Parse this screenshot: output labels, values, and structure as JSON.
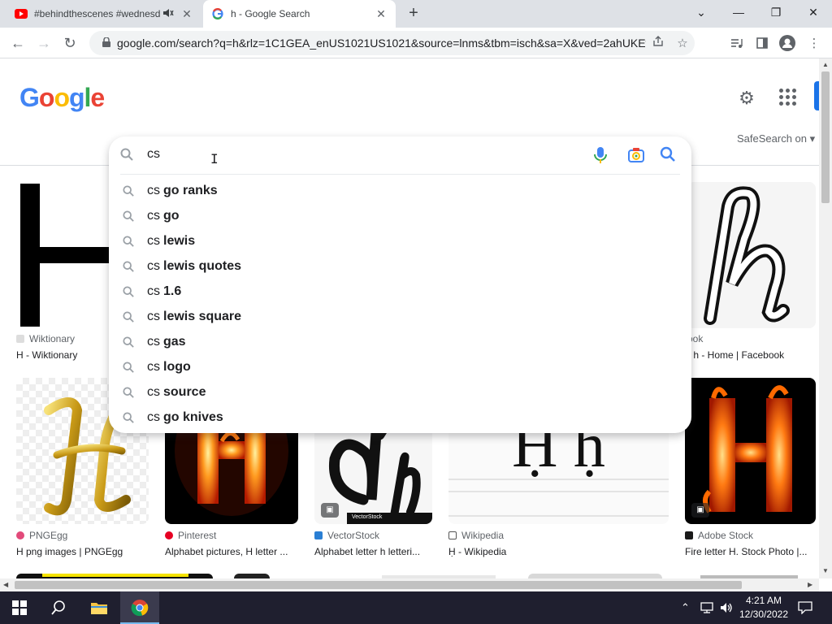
{
  "browser": {
    "tabs": [
      {
        "title": "#behindthescenes #wednesd",
        "active": false,
        "favicon": "youtube-icon"
      },
      {
        "title": "h - Google Search",
        "active": true,
        "favicon": "google-g-icon"
      }
    ],
    "url": "google.com/search?q=h&rlz=1C1GEA_enUS1021US1021&source=lnms&tbm=isch&sa=X&ved=2ahUKEw..."
  },
  "search": {
    "query": "cs",
    "suggestions": [
      {
        "prefix": "cs",
        "completion": "go ranks"
      },
      {
        "prefix": "cs",
        "completion": "go"
      },
      {
        "prefix": "cs",
        "completion": "lewis"
      },
      {
        "prefix": "cs",
        "completion": "lewis quotes"
      },
      {
        "prefix": "cs",
        "completion": "1.6"
      },
      {
        "prefix": "cs",
        "completion": "lewis square"
      },
      {
        "prefix": "cs",
        "completion": "gas"
      },
      {
        "prefix": "cs",
        "completion": "logo"
      },
      {
        "prefix": "cs",
        "completion": "source"
      },
      {
        "prefix": "cs",
        "completion": "go knives"
      }
    ]
  },
  "header": {
    "logo_letters": [
      "G",
      "o",
      "o",
      "g",
      "l",
      "e"
    ],
    "safesearch": "SafeSearch on"
  },
  "results": {
    "row1": [
      {
        "source": "Wiktionary",
        "title": "H - Wiktionary"
      },
      {
        "source": "ook",
        "title": "r h - Home | Facebook"
      }
    ],
    "row2": [
      {
        "source": "PNGEgg",
        "title": "H png images | PNGEgg"
      },
      {
        "source": "Pinterest",
        "title": "Alphabet pictures, H letter ..."
      },
      {
        "source": "VectorStock",
        "title": "Alphabet letter h letteri..."
      },
      {
        "source": "Wikipedia",
        "title": "Ḥ - Wikipedia"
      },
      {
        "source": "Adobe Stock",
        "title": "Fire letter H. Stock Photo |..."
      }
    ],
    "wiki_image_text": "Ḥ ḥ",
    "vectorstock_watermark": "VectorStock"
  },
  "taskbar": {
    "time": "4:21 AM",
    "date": "12/30/2022"
  },
  "colors": {
    "google_blue": "#4285f4",
    "google_red": "#ea4335",
    "google_yellow": "#fbbc05",
    "google_green": "#34a853",
    "taskbar": "#1f1f2f"
  }
}
